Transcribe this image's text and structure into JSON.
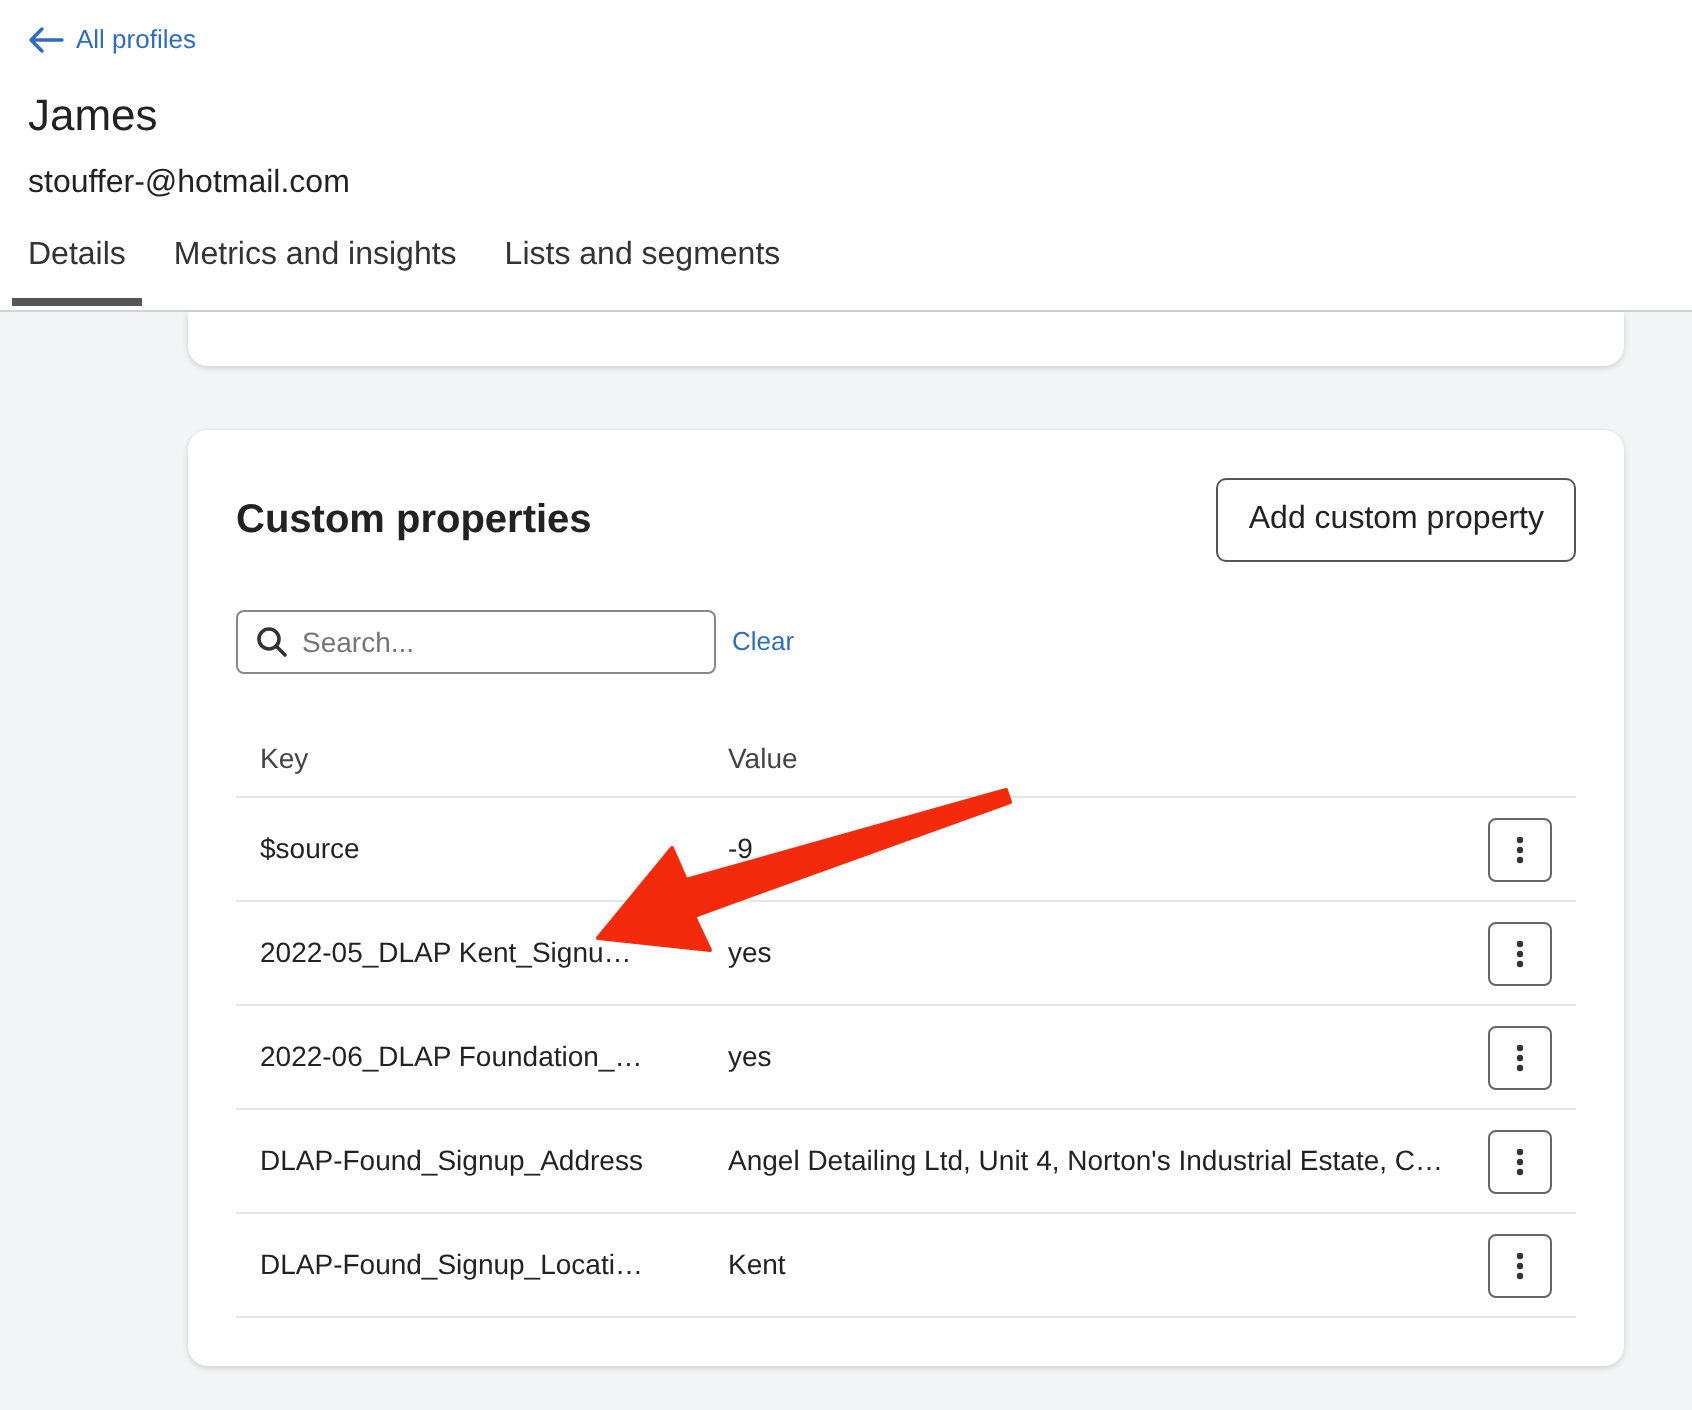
{
  "back_link": {
    "label": "All profiles"
  },
  "profile": {
    "name": "James",
    "email": "stouffer-@hotmail.com"
  },
  "tabs": [
    {
      "label": "Details",
      "selected": true
    },
    {
      "label": "Metrics and insights",
      "selected": false
    },
    {
      "label": "Lists and segments",
      "selected": false
    }
  ],
  "custom_properties": {
    "title": "Custom properties",
    "add_button": "Add custom property",
    "search": {
      "placeholder": "Search..."
    },
    "clear": "Clear",
    "columns": [
      "Key",
      "Value"
    ],
    "rows": [
      {
        "key": "$source",
        "value": "-9"
      },
      {
        "key": "2022-05_DLAP Kent_Signu…",
        "value": "yes"
      },
      {
        "key": "2022-06_DLAP Foundation_…",
        "value": "yes"
      },
      {
        "key": "DLAP-Found_Signup_Address",
        "value": "Angel Detailing Ltd, Unit 4, Norton's Industrial Estate, C…"
      },
      {
        "key": "DLAP-Found_Signup_Locati…",
        "value": "Kent"
      }
    ]
  }
}
